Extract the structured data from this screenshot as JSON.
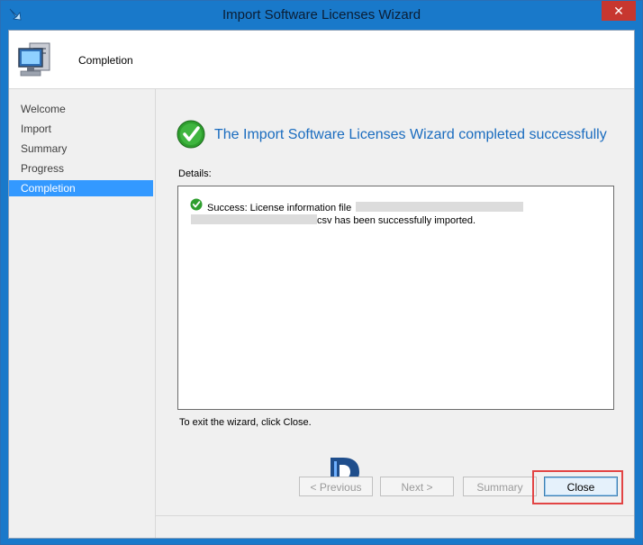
{
  "window": {
    "title": "Import Software Licenses Wizard",
    "close_glyph": "✕"
  },
  "header": {
    "title": "Completion",
    "icon": "computer-icon"
  },
  "nav": {
    "items": [
      {
        "label": "Welcome",
        "active": false
      },
      {
        "label": "Import",
        "active": false
      },
      {
        "label": "Summary",
        "active": false
      },
      {
        "label": "Progress",
        "active": false
      },
      {
        "label": "Completion",
        "active": true
      }
    ]
  },
  "content": {
    "headline": "The Import Software Licenses Wizard completed successfully",
    "details_label": "Details:",
    "message_line1": "Success: License information file",
    "message_line2_suffix": "csv has been successfully imported.",
    "exit_hint": "To exit the wizard, click Close."
  },
  "buttons": {
    "previous": "< Previous",
    "next": "Next >",
    "summary": "Summary",
    "close": "Close"
  },
  "colors": {
    "titlebar": "#1979ca",
    "accent_text": "#1a6cbf",
    "nav_active": "#3399ff",
    "success_green": "#2e9e2e",
    "highlight_red": "#e24444"
  }
}
